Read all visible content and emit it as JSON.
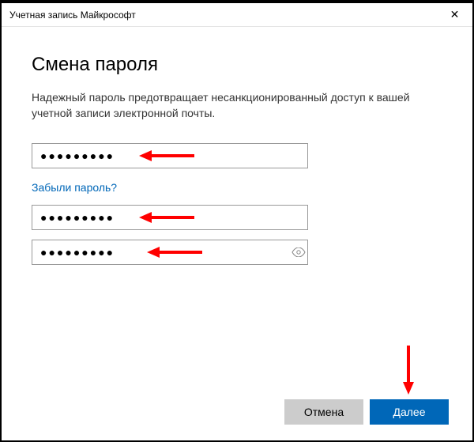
{
  "window": {
    "title": "Учетная запись Майкрософт"
  },
  "page": {
    "heading": "Смена пароля",
    "description": "Надежный пароль предотвращает несанкционированный доступ к вашей учетной записи электронной почты."
  },
  "fields": {
    "current_password": {
      "value": "●●●●●●●●●"
    },
    "new_password": {
      "value": "●●●●●●●●●"
    },
    "confirm_password": {
      "value": "●●●●●●●●●"
    }
  },
  "links": {
    "forgot": "Забыли пароль?"
  },
  "buttons": {
    "cancel": "Отмена",
    "next": "Далее"
  },
  "icons": {
    "close": "✕"
  }
}
